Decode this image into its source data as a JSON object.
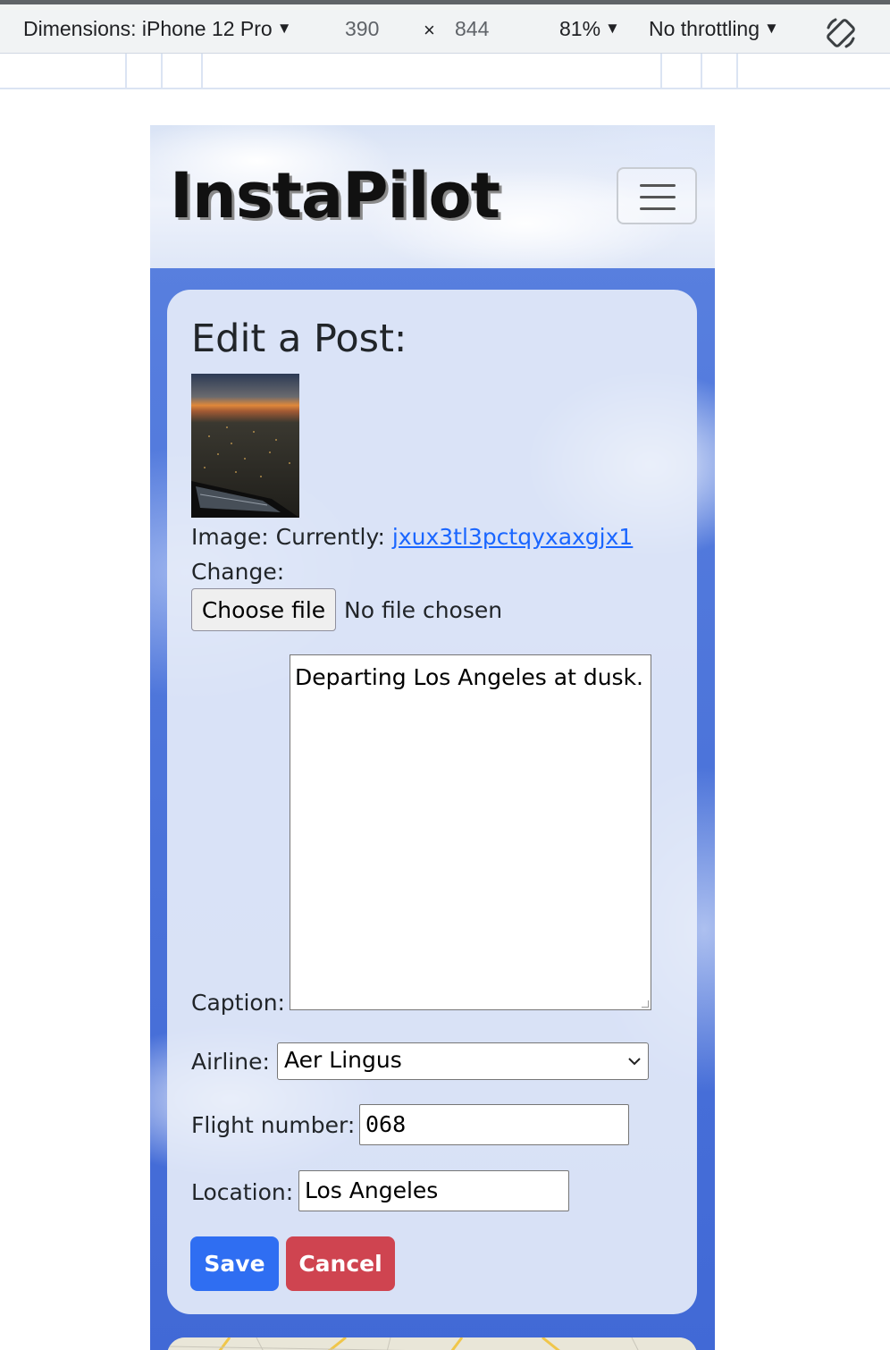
{
  "devtools": {
    "dimensions_label": "Dimensions: iPhone 12 Pro",
    "width_value": "390",
    "times_symbol": "×",
    "height_value": "844",
    "zoom": "81%",
    "throttling": "No throttling",
    "rotate_icon": "rotate-icon"
  },
  "navbar": {
    "brand": "InstaPilot",
    "menu_icon": "hamburger-menu-icon"
  },
  "form": {
    "heading": "Edit a Post:",
    "image_label": "Image: Currently:",
    "image_link": "jxux3tl3pctqyxaxgjx1",
    "change_label": "Change:",
    "choose_file_label": "Choose file",
    "file_status": "No file chosen",
    "caption_label": "Caption:",
    "caption_value": "Departing Los Angeles at dusk.",
    "airline_label": "Airline:",
    "airline_value": "Aer Lingus",
    "flight_label": "Flight number:",
    "flight_value": "068",
    "location_label": "Location:",
    "location_value": "Los Angeles",
    "save_label": "Save",
    "cancel_label": "Cancel"
  },
  "colors": {
    "save": "#2f6ef2",
    "cancel": "#cf4450",
    "link": "#1a66ff",
    "sky": "#4a72d9"
  }
}
